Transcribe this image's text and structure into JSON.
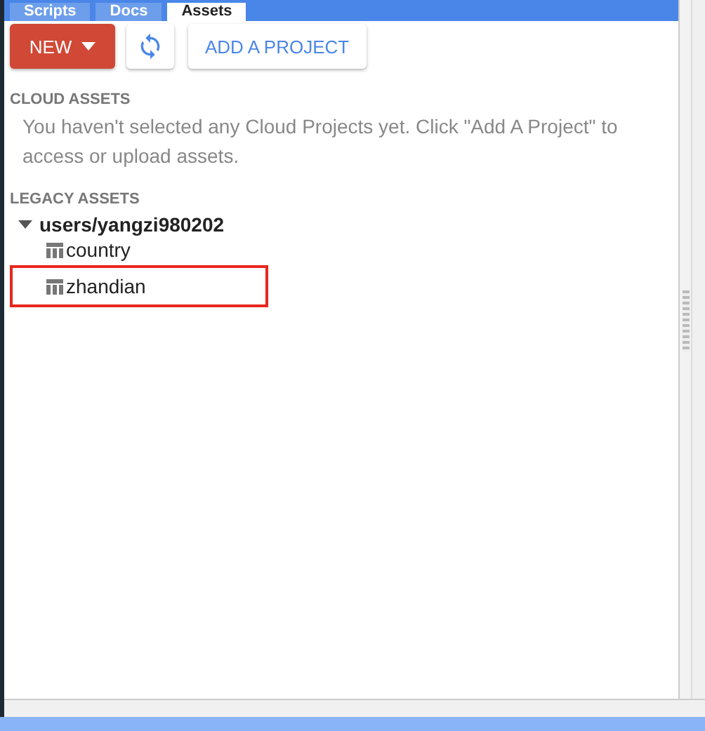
{
  "tabs": [
    {
      "label": "Scripts",
      "selected": false
    },
    {
      "label": "Docs",
      "selected": false
    },
    {
      "label": "Assets",
      "selected": true
    }
  ],
  "toolbar": {
    "new_button": "NEW",
    "add_project_button": "ADD A PROJECT"
  },
  "cloud_assets": {
    "heading": "CLOUD ASSETS",
    "message": "You haven't selected any Cloud Projects yet. Click \"Add A Project\" to access or upload assets."
  },
  "legacy_assets": {
    "heading": "LEGACY ASSETS",
    "tree": [
      {
        "label": "users/yangzi980202",
        "expanded": true,
        "children": [
          {
            "label": "country",
            "highlighted": false
          },
          {
            "label": "zhandian",
            "highlighted": true
          }
        ]
      }
    ]
  }
}
